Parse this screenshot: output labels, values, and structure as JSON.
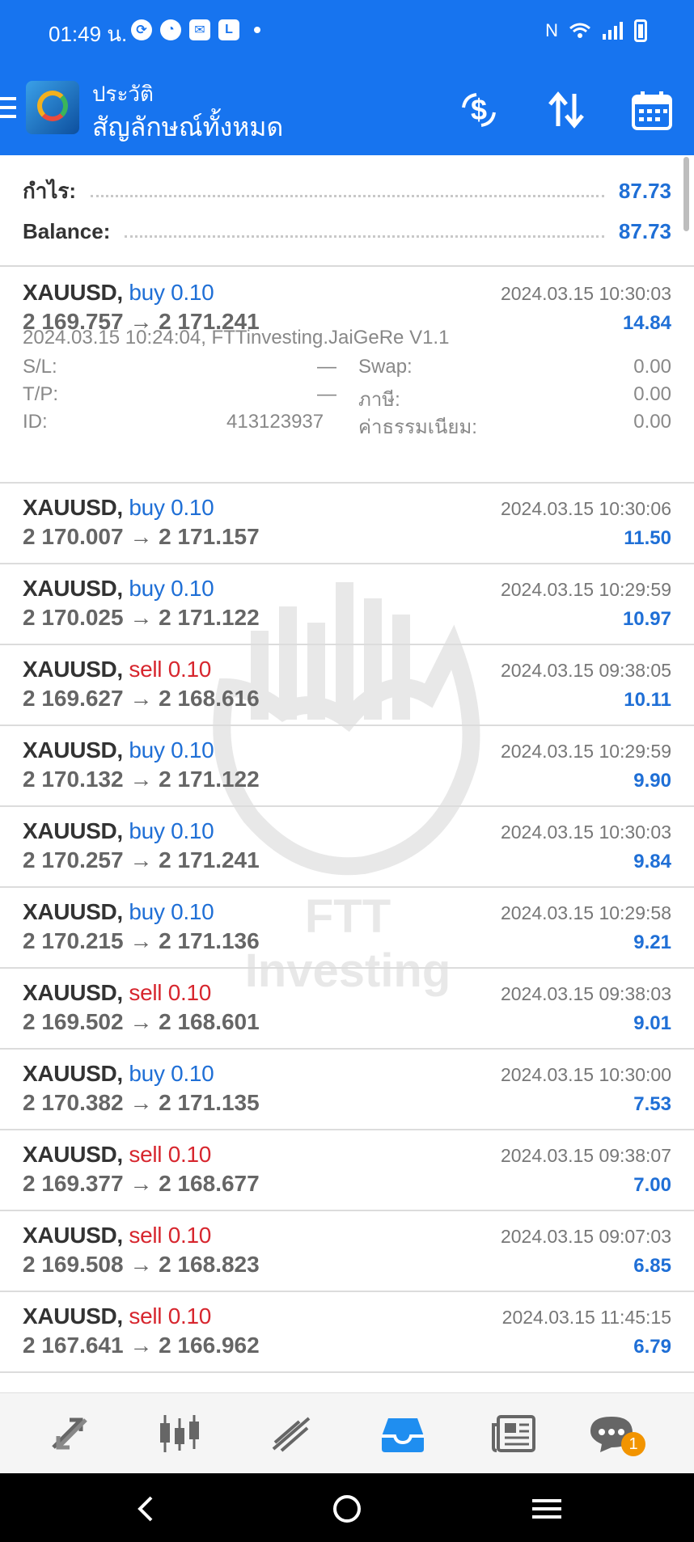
{
  "status_bar": {
    "time": "01:49 น.",
    "icons": [
      "clock-icon",
      "speed-icon",
      "mail-icon",
      "shield-icon"
    ],
    "right_icons": [
      "nfc-icon",
      "wifi-icon",
      "signal-icon",
      "battery-icon"
    ]
  },
  "app_bar": {
    "title": "ประวัติ",
    "subtitle": "สัญลักษณ์ทั้งหมด",
    "actions": [
      "currency-exchange-icon",
      "sort-icon",
      "calendar-icon"
    ]
  },
  "summary": {
    "profit_label": "กำไร:",
    "profit_value": "87.73",
    "balance_label": "Balance:",
    "balance_value": "87.73"
  },
  "expanded_deal": {
    "open_info": "2024.03.15 10:24:04, FTTinvesting.JaiGeRe V1.1",
    "sl_label": "S/L:",
    "sl_value": "—",
    "tp_label": "T/P:",
    "tp_value": "—",
    "id_label": "ID:",
    "id_value": "413123937",
    "swap_label": "Swap:",
    "swap_value": "0.00",
    "tax_label": "ภาษี:",
    "tax_value": "0.00",
    "fee_label": "ค่าธรรมเนียม:",
    "fee_value": "0.00"
  },
  "deals": [
    {
      "symbol": "XAUUSD,",
      "side": "buy",
      "volume": "0.10",
      "prices": "2 169.757 → 2 171.241",
      "time": "2024.03.15 10:30:03",
      "profit": "14.84"
    },
    {
      "symbol": "XAUUSD,",
      "side": "buy",
      "volume": "0.10",
      "prices": "2 170.007 → 2 171.157",
      "time": "2024.03.15 10:30:06",
      "profit": "11.50"
    },
    {
      "symbol": "XAUUSD,",
      "side": "buy",
      "volume": "0.10",
      "prices": "2 170.025 → 2 171.122",
      "time": "2024.03.15 10:29:59",
      "profit": "10.97"
    },
    {
      "symbol": "XAUUSD,",
      "side": "sell",
      "volume": "0.10",
      "prices": "2 169.627 → 2 168.616",
      "time": "2024.03.15 09:38:05",
      "profit": "10.11"
    },
    {
      "symbol": "XAUUSD,",
      "side": "buy",
      "volume": "0.10",
      "prices": "2 170.132 → 2 171.122",
      "time": "2024.03.15 10:29:59",
      "profit": "9.90"
    },
    {
      "symbol": "XAUUSD,",
      "side": "buy",
      "volume": "0.10",
      "prices": "2 170.257 → 2 171.241",
      "time": "2024.03.15 10:30:03",
      "profit": "9.84"
    },
    {
      "symbol": "XAUUSD,",
      "side": "buy",
      "volume": "0.10",
      "prices": "2 170.215 → 2 171.136",
      "time": "2024.03.15 10:29:58",
      "profit": "9.21"
    },
    {
      "symbol": "XAUUSD,",
      "side": "sell",
      "volume": "0.10",
      "prices": "2 169.502 → 2 168.601",
      "time": "2024.03.15 09:38:03",
      "profit": "9.01"
    },
    {
      "symbol": "XAUUSD,",
      "side": "buy",
      "volume": "0.10",
      "prices": "2 170.382 → 2 171.135",
      "time": "2024.03.15 10:30:00",
      "profit": "7.53"
    },
    {
      "symbol": "XAUUSD,",
      "side": "sell",
      "volume": "0.10",
      "prices": "2 169.377 → 2 168.677",
      "time": "2024.03.15 09:38:07",
      "profit": "7.00"
    },
    {
      "symbol": "XAUUSD,",
      "side": "sell",
      "volume": "0.10",
      "prices": "2 169.508 → 2 168.823",
      "time": "2024.03.15 09:07:03",
      "profit": "6.85"
    },
    {
      "symbol": "XAUUSD,",
      "side": "sell",
      "volume": "0.10",
      "prices": "2 167.641 → 2 166.962",
      "time": "2024.03.15 11:45:15",
      "profit": "6.79"
    }
  ],
  "watermark": {
    "text": "FTT Investing"
  },
  "bottom_nav": {
    "items": [
      "quotes-icon",
      "chart-icon",
      "trade-icon",
      "history-icon",
      "news-icon",
      "chat-icon"
    ],
    "active": "history-icon",
    "chat_badge": "1"
  },
  "system_nav": [
    "back-icon",
    "home-icon",
    "recents-icon"
  ],
  "colors": {
    "accent": "#1774ef",
    "buy": "#1f6fd6",
    "sell": "#d7262e"
  }
}
